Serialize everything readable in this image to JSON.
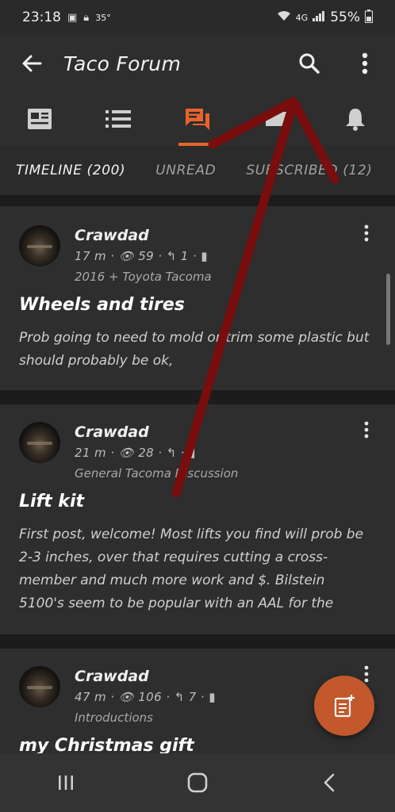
{
  "status_bar": {
    "time": "23:18",
    "temperature": "35°",
    "network": "4G",
    "battery": "55%"
  },
  "app_bar": {
    "title": "Taco Forum",
    "icons": [
      "back-arrow-icon",
      "search-icon",
      "more-vert-icon"
    ]
  },
  "tab_icons": [
    {
      "name": "news",
      "icon": "article-icon",
      "active": false
    },
    {
      "name": "list",
      "icon": "list-icon",
      "active": false
    },
    {
      "name": "forum",
      "icon": "forum-icon",
      "active": true
    },
    {
      "name": "messages",
      "icon": "message-icon",
      "active": false
    },
    {
      "name": "notifications",
      "icon": "bell-icon",
      "active": false
    }
  ],
  "filter_tabs": [
    {
      "label": "TIMELINE (200)",
      "active": true
    },
    {
      "label": "UNREAD",
      "active": false
    },
    {
      "label": "SUBSCRIBED (12)",
      "active": false
    }
  ],
  "posts": [
    {
      "username": "Crawdad",
      "time": "17 m",
      "views": "59",
      "replies": "1",
      "category": "2016 + Toyota Tacoma",
      "title": "Wheels and tires",
      "body": "Prob going to need to mold or trim some plastic but should probably be ok,"
    },
    {
      "username": "Crawdad",
      "time": "21 m",
      "views": "28",
      "replies": "",
      "category": "General Tacoma Discussion",
      "title": "Lift kit",
      "body": "First post, welcome! Most lifts you find will prob be 2-3 inches, over that requires cutting a cross-member and much more work and $. Bilstein 5100's seem to be popular with an AAL for the"
    },
    {
      "username": "Crawdad",
      "time": "47 m",
      "views": "106",
      "replies": "7",
      "category": "Introductions",
      "title": "my Christmas gift",
      "body": ""
    }
  ],
  "colors": {
    "accent": "#e8642c",
    "fab": "#c2582b",
    "annotation": "#7a0d0d",
    "background": "#1f1f1f",
    "card": "#2e2e2e"
  },
  "nav_bar": {
    "icons": [
      "recents-icon",
      "home-icon",
      "back-icon"
    ]
  }
}
